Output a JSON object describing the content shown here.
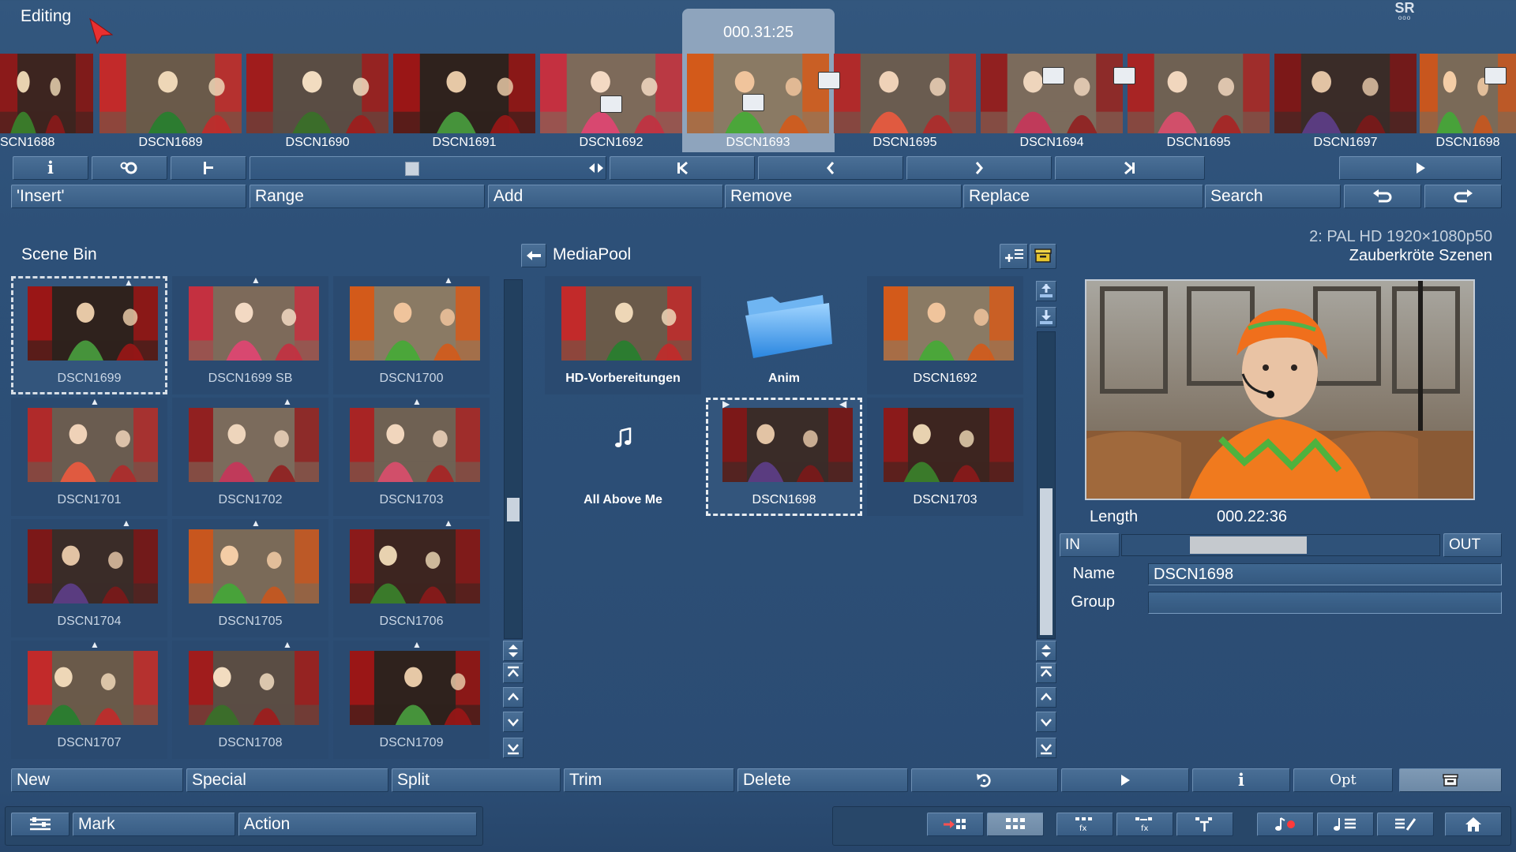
{
  "header": {
    "mode_title": "Editing",
    "timecode": "000.31:25",
    "sr_badge": "SR"
  },
  "timeline": {
    "clips": [
      {
        "label": "SCN1688"
      },
      {
        "label": "DSCN1689"
      },
      {
        "label": "DSCN1690"
      },
      {
        "label": "DSCN1691"
      },
      {
        "label": "DSCN1692"
      },
      {
        "label": "DSCN1693"
      },
      {
        "label": "DSCN1695"
      },
      {
        "label": "DSCN1694"
      },
      {
        "label": "DSCN1695"
      },
      {
        "label": "DSCN1697"
      },
      {
        "label": "DSCN1698"
      }
    ],
    "selected_index": 5
  },
  "toolbar_top": {
    "insert": "'Insert'",
    "range": "Range",
    "add": "Add",
    "remove": "Remove",
    "replace": "Replace",
    "search": "Search"
  },
  "scene_bin": {
    "title": "Scene Bin",
    "items": [
      {
        "label": "DSCN1699"
      },
      {
        "label": "DSCN1699 SB"
      },
      {
        "label": "DSCN1700"
      },
      {
        "label": "DSCN1701"
      },
      {
        "label": "DSCN1702"
      },
      {
        "label": "DSCN1703"
      },
      {
        "label": "DSCN1704"
      },
      {
        "label": "DSCN1705"
      },
      {
        "label": "DSCN1706"
      },
      {
        "label": "DSCN1707"
      },
      {
        "label": "DSCN1708"
      },
      {
        "label": "DSCN1709"
      }
    ]
  },
  "media_pool": {
    "title": "MediaPool",
    "items": [
      {
        "label": "HD-Vorbereitungen",
        "kind": "video"
      },
      {
        "label": "Anim",
        "kind": "folder"
      },
      {
        "label": "DSCN1692",
        "kind": "video"
      },
      {
        "label": "All Above Me",
        "kind": "audio"
      },
      {
        "label": "DSCN1698",
        "kind": "video"
      },
      {
        "label": "DSCN1703",
        "kind": "video"
      }
    ]
  },
  "project": {
    "format": "2: PAL HD 1920×1080p50",
    "name": "Zauberkröte Szenen"
  },
  "preview": {
    "length_label": "Length",
    "length_value": "000.22:36",
    "in_label": "IN",
    "out_label": "OUT",
    "name_label": "Name",
    "name_value": "DSCN1698",
    "group_label": "Group",
    "group_value": ""
  },
  "toolbar_bottom": {
    "new": "New",
    "special": "Special",
    "split": "Split",
    "trim": "Trim",
    "delete": "Delete",
    "opt": "Opt"
  },
  "status_bar": {
    "mark": "Mark",
    "action": "Action"
  },
  "colors": {
    "background": "#2d5078",
    "panel": "#2a4a70",
    "button": "#416690",
    "selected_clip": "#8ea4bd"
  }
}
